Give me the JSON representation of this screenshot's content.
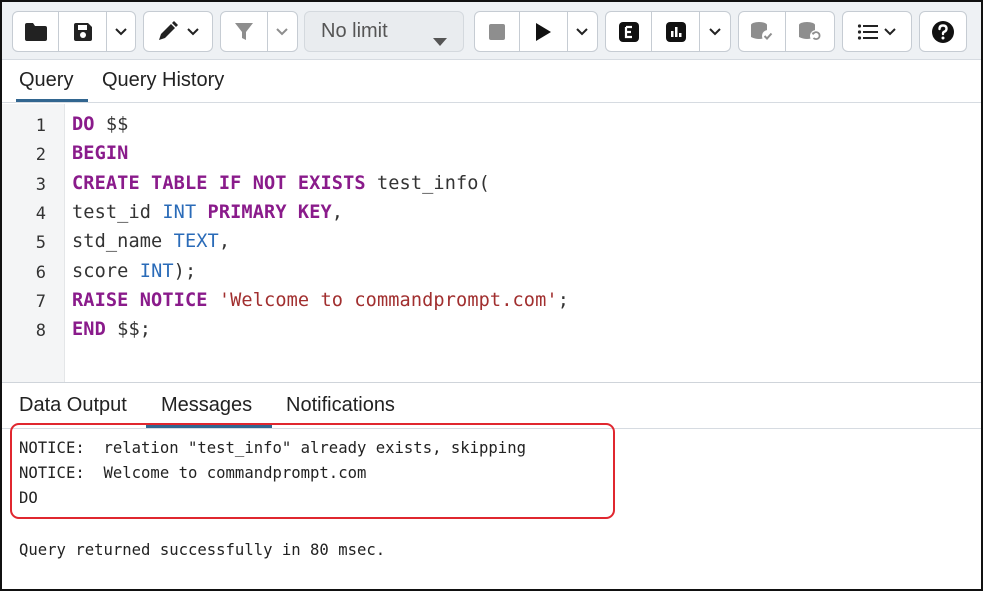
{
  "toolbar": {
    "limit": {
      "value": "No limit",
      "options": [
        "No limit"
      ]
    },
    "icons": [
      "folder-open-icon",
      "save-icon",
      "chevron-down-icon",
      "edit-pen-icon",
      "filter-icon",
      "stop-icon",
      "play-icon",
      "explain-icon",
      "explain-analyze-icon",
      "commit-icon",
      "rollback-icon",
      "macros-icon",
      "help-icon"
    ]
  },
  "editor_tabs": [
    {
      "label": "Query",
      "active": true
    },
    {
      "label": "Query History",
      "active": false
    }
  ],
  "editor": {
    "line_numbers": [
      "1",
      "2",
      "3",
      "4",
      "5",
      "6",
      "7",
      "8"
    ],
    "lines": [
      [
        {
          "t": "DO",
          "c": "kw"
        },
        {
          "t": " $$",
          "c": "pn"
        }
      ],
      [
        {
          "t": "BEGIN",
          "c": "kw"
        }
      ],
      [
        {
          "t": "CREATE TABLE IF NOT EXISTS",
          "c": "kw"
        },
        {
          "t": " test_info(",
          "c": "pn"
        }
      ],
      [
        {
          "t": "test_id ",
          "c": "pn"
        },
        {
          "t": "INT",
          "c": "ty"
        },
        {
          "t": " ",
          "c": "pn"
        },
        {
          "t": "PRIMARY KEY",
          "c": "kw"
        },
        {
          "t": ",",
          "c": "pn"
        }
      ],
      [
        {
          "t": "std_name ",
          "c": "pn"
        },
        {
          "t": "TEXT",
          "c": "ty"
        },
        {
          "t": ",",
          "c": "pn"
        }
      ],
      [
        {
          "t": "score ",
          "c": "pn"
        },
        {
          "t": "INT",
          "c": "ty"
        },
        {
          "t": ");",
          "c": "pn"
        }
      ],
      [
        {
          "t": "RAISE NOTICE",
          "c": "kw"
        },
        {
          "t": " ",
          "c": "pn"
        },
        {
          "t": "'Welcome to commandprompt.com'",
          "c": "st"
        },
        {
          "t": ";",
          "c": "pn"
        }
      ],
      [
        {
          "t": "END",
          "c": "kw"
        },
        {
          "t": " $$;",
          "c": "pn"
        }
      ]
    ]
  },
  "result_tabs": [
    {
      "label": "Data Output",
      "active": false
    },
    {
      "label": "Messages",
      "active": true
    },
    {
      "label": "Notifications",
      "active": false
    }
  ],
  "messages": {
    "lines": [
      "NOTICE:  relation \"test_info\" already exists, skipping",
      "NOTICE:  Welcome to commandprompt.com",
      "DO"
    ],
    "summary": "Query returned successfully in 80 msec."
  },
  "colors": {
    "keyword": "#8a1b8b",
    "type": "#2a6bb8",
    "string": "#a12f2f",
    "active_tab_underline": "#326690",
    "highlight_box": "#e0272f"
  }
}
